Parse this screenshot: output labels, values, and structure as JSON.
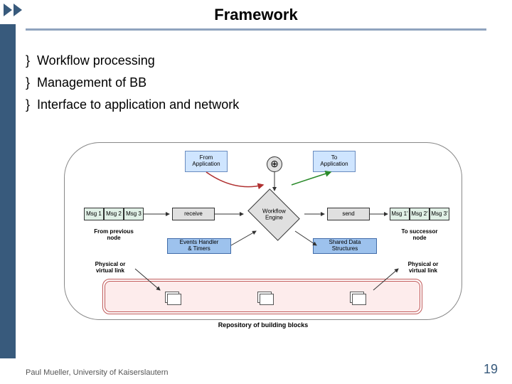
{
  "title": "Framework",
  "bullets": [
    "Workflow processing",
    "Management of BB",
    "Interface to application and network"
  ],
  "diagram": {
    "from_app": "From\nApplication",
    "to_app": "To\nApplication",
    "msgs_in": [
      "Msg 1",
      "Msg 2",
      "Msg 3"
    ],
    "msgs_out": [
      "Msg 1'",
      "Msg 2'",
      "Msg 3'"
    ],
    "receive": "receive",
    "send": "send",
    "engine": "Workflow\nEngine",
    "events": "Events Handler\n& Timers",
    "shared": "Shared Data\nStructures",
    "from_prev": "From previous\nnode",
    "to_succ": "To successor\nnode",
    "phys": "Physical or\nvirtual link",
    "repo": "Repository of building blocks"
  },
  "footer": {
    "left": "Paul Mueller, University of Kaiserslautern",
    "right": "19"
  }
}
